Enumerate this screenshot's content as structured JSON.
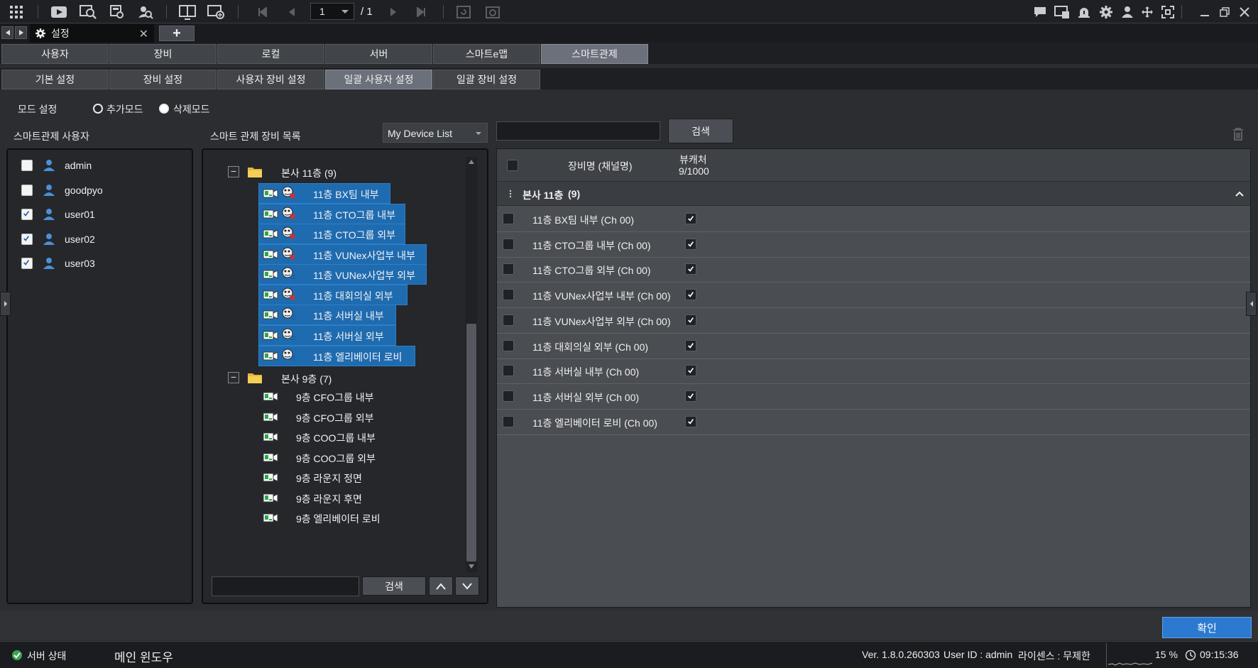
{
  "toolbar": {
    "page_current": "1",
    "page_separator": "/ 1"
  },
  "doc_tab": {
    "title": "설정",
    "add_label": "+"
  },
  "main_tabs": [
    "사용자",
    "장비",
    "로컬",
    "서버",
    "스마트e맵",
    "스마트관제"
  ],
  "main_tab_active": "스마트관제",
  "sub_tabs": [
    "기본 설정",
    "장비 설정",
    "사용자 장비 설정",
    "일괄 사용자 설정",
    "일괄 장비 설정"
  ],
  "sub_tab_active": "일괄 사용자 설정",
  "mode": {
    "label": "모드 설정",
    "add": "추가모드",
    "delete": "삭제모드",
    "selected": "삭제모드"
  },
  "users_panel": {
    "title": "스마트관제 사용자",
    "users": [
      {
        "name": "admin",
        "checked": false
      },
      {
        "name": "goodpyo",
        "checked": false
      },
      {
        "name": "user01",
        "checked": true
      },
      {
        "name": "user02",
        "checked": true
      },
      {
        "name": "user03",
        "checked": true
      }
    ]
  },
  "device_panel": {
    "title": "스마트 관제 장비 목록",
    "list_select": "My Device List",
    "search_label": "검색",
    "groups": [
      {
        "name": "본사 11층 (9)",
        "items": [
          {
            "name": "11층 BX팀 내부",
            "status": "error"
          },
          {
            "name": "11층 CTO그룹 내부",
            "status": "error"
          },
          {
            "name": "11층 CTO그룹 외부",
            "status": "error"
          },
          {
            "name": "11층 VUNex사업부 내부",
            "status": "error"
          },
          {
            "name": "11층 VUNex사업부 외부",
            "status": "ok"
          },
          {
            "name": "11층 대회의실 외부",
            "status": "error"
          },
          {
            "name": "11층 서버실 내부",
            "status": "ok"
          },
          {
            "name": "11층 서버실 외부",
            "status": "ok"
          },
          {
            "name": "11층 엘리베이터 로비",
            "status": "ok"
          }
        ]
      },
      {
        "name": "본사 9층 (7)",
        "items": [
          {
            "name": "9층 CFO그룹 내부"
          },
          {
            "name": "9층 CFO그룹 외부"
          },
          {
            "name": "9층 COO그룹 내부"
          },
          {
            "name": "9층 COO그룹 외부"
          },
          {
            "name": "9층 라운지 정면"
          },
          {
            "name": "9층 라운지 후면"
          },
          {
            "name": "9층 엘리베이터 로비"
          }
        ]
      }
    ]
  },
  "right_panel": {
    "search_label": "검색",
    "col_device": "장비명 (채널명)",
    "col_viewer": "뷰캐처",
    "viewer_count": "9/1000",
    "group_name": "본사 11층",
    "group_count": "(9)",
    "rows": [
      "11층 BX팀 내부 (Ch 00)",
      "11층 CTO그룹 내부 (Ch 00)",
      "11층 CTO그룹 외부 (Ch 00)",
      "11층 VUNex사업부 내부 (Ch 00)",
      "11층 VUNex사업부 외부 (Ch 00)",
      "11층 대회의실 외부 (Ch 00)",
      "11층 서버실 내부 (Ch 00)",
      "11층 서버실 외부 (Ch 00)",
      "11층 엘리베이터 로비 (Ch 00)"
    ]
  },
  "ok_button": "확인",
  "status_bar": {
    "server_status": "서버 상태",
    "window_name": "메인 윈도우",
    "version": "Ver. 1.8.0.260303",
    "user_id": "User ID : admin",
    "license": "라이센스 : 무제한",
    "cpu": "15 %",
    "clock": "09:15:36"
  },
  "colors": {
    "accent": "#2c7ad0",
    "selection": "#1f6bb0",
    "background": "#2b2d31"
  }
}
